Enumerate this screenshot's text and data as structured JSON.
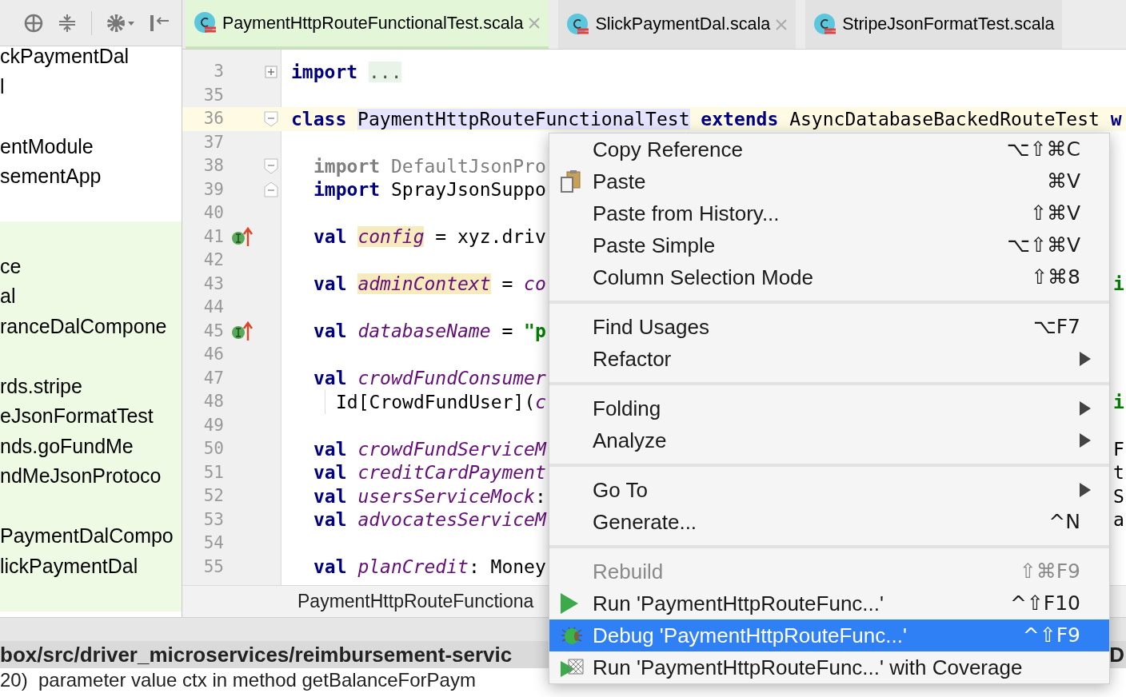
{
  "project_tree": {
    "items": [
      {
        "label": "ckPaymentDal",
        "highlighted": false
      },
      {
        "label": "l",
        "highlighted": false
      },
      {
        "highlighted": false
      },
      {
        "label": "entModule",
        "highlighted": false
      },
      {
        "label": "sementApp",
        "highlighted": false
      },
      {
        "highlighted": false
      },
      {
        "highlighted": true
      },
      {
        "label": "ce",
        "highlighted": true
      },
      {
        "label": "al",
        "highlighted": true
      },
      {
        "label": "ranceDalCompone",
        "highlighted": true
      },
      {
        "highlighted": true
      },
      {
        "label": "rds.stripe",
        "highlighted": true
      },
      {
        "label": "eJsonFormatTest",
        "highlighted": true
      },
      {
        "label": "nds.goFundMe",
        "highlighted": true
      },
      {
        "label": "ndMeJsonProtoco",
        "highlighted": true
      },
      {
        "highlighted": true
      },
      {
        "label": "PaymentDalCompo",
        "highlighted": true
      },
      {
        "label": "lickPaymentDal",
        "highlighted": true
      },
      {
        "highlighted": true
      }
    ]
  },
  "tabs": [
    {
      "label": "PaymentHttpRouteFunctionalTest.scala",
      "selected": true,
      "closable": true
    },
    {
      "label": "SlickPaymentDal.scala",
      "selected": false,
      "closable": true
    },
    {
      "label": "StripeJsonFormatTest.scala",
      "selected": false,
      "closable": false
    }
  ],
  "editor": {
    "lines": [
      {
        "number": "3",
        "fold": {
          "kind": "expand"
        },
        "tokens": [
          {
            "text": "import ",
            "kind": "kw"
          },
          {
            "text": "...",
            "kind": "folded"
          }
        ]
      },
      {
        "number": "35"
      },
      {
        "number": "36",
        "current": true,
        "fold": {
          "kind": "start"
        },
        "tokens": [
          {
            "text": "class ",
            "kind": "kw"
          },
          {
            "text": "PaymentHttpRouteFunctionalTest",
            "kind": "classhl"
          },
          {
            "text": " extends",
            "kind": "kw"
          },
          {
            "text": " AsyncDatabaseBackedRouteTest",
            "kind": "plain"
          },
          {
            "text": " w",
            "kind": "kw"
          }
        ]
      },
      {
        "number": "37"
      },
      {
        "number": "38",
        "fold": {
          "kind": "start"
        },
        "kind": "member",
        "tokens": [
          {
            "text": "import",
            "kind": "unusedkw"
          },
          {
            "text": " DefaultJsonPro",
            "kind": "unused"
          }
        ]
      },
      {
        "number": "39",
        "fold": {
          "kind": "end"
        },
        "kind": "member",
        "tokens": [
          {
            "text": "import",
            "kind": "kw"
          },
          {
            "text": " SprayJsonSuppo",
            "kind": "plain"
          }
        ]
      },
      {
        "number": "40"
      },
      {
        "number": "41",
        "marker": true,
        "kind": "member",
        "tokens": [
          {
            "text": "val ",
            "kind": "kw"
          },
          {
            "text": "config",
            "kind": "fieldhl"
          },
          {
            "text": " = xyz.driv",
            "kind": "plain"
          }
        ]
      },
      {
        "number": "42"
      },
      {
        "number": "43",
        "kind": "member",
        "tokens": [
          {
            "text": "val ",
            "kind": "kw"
          },
          {
            "text": "adminContext",
            "kind": "fieldhl"
          },
          {
            "text": " = ",
            "kind": "plain"
          },
          {
            "text": "co",
            "kind": "field"
          }
        ],
        "right": {
          "text": "i",
          "kind": "str"
        }
      },
      {
        "number": "44"
      },
      {
        "number": "45",
        "marker": true,
        "kind": "member",
        "tokens": [
          {
            "text": "val ",
            "kind": "kw"
          },
          {
            "text": "databaseName",
            "kind": "field"
          },
          {
            "text": " = ",
            "kind": "plain"
          },
          {
            "text": "\"p",
            "kind": "str"
          }
        ]
      },
      {
        "number": "46"
      },
      {
        "number": "47",
        "kind": "member",
        "tokens": [
          {
            "text": "val ",
            "kind": "kw"
          },
          {
            "text": "crowdFundConsumer",
            "kind": "field"
          }
        ]
      },
      {
        "number": "48",
        "kind": "continuation",
        "tokens": [
          {
            "text": "Id[CrowdFundUser](",
            "kind": "plain"
          },
          {
            "text": "c",
            "kind": "field"
          }
        ],
        "right": {
          "text": "i",
          "kind": "str"
        }
      },
      {
        "number": "49"
      },
      {
        "number": "50",
        "kind": "member",
        "tokens": [
          {
            "text": "val ",
            "kind": "kw"
          },
          {
            "text": "crowdFundServiceM",
            "kind": "field"
          }
        ],
        "right": {
          "text": "F",
          "kind": "plain"
        }
      },
      {
        "number": "51",
        "kind": "member",
        "tokens": [
          {
            "text": "val ",
            "kind": "kw"
          },
          {
            "text": "creditCardPayment",
            "kind": "field"
          }
        ],
        "right": {
          "text": "t",
          "kind": "plain"
        }
      },
      {
        "number": "52",
        "kind": "member",
        "tokens": [
          {
            "text": "val ",
            "kind": "kw"
          },
          {
            "text": "usersServiceMock",
            "kind": "field"
          },
          {
            "text": ":",
            "kind": "plain"
          }
        ],
        "right": {
          "text": "S",
          "kind": "plain"
        }
      },
      {
        "number": "53",
        "kind": "member",
        "tokens": [
          {
            "text": "val ",
            "kind": "kw"
          },
          {
            "text": "advocatesServiceM",
            "kind": "field"
          }
        ],
        "right": {
          "text": "a",
          "kind": "plain"
        }
      },
      {
        "number": "54"
      },
      {
        "number": "55",
        "kind": "member",
        "tokens": [
          {
            "text": "val ",
            "kind": "kw"
          },
          {
            "text": "planCredit",
            "kind": "field"
          },
          {
            "text": ": Money",
            "kind": "plain"
          }
        ]
      }
    ],
    "breadcrumb": "PaymentHttpRouteFunctiona"
  },
  "context_menu": {
    "items": [
      {
        "kind": "item",
        "label": "Copy Reference",
        "shortcut": "⌥⇧⌘C",
        "selected": false,
        "disabled": false
      },
      {
        "kind": "item",
        "label": "Paste",
        "shortcut": "⌘V",
        "icon": {
          "kind": "paste"
        },
        "selected": false,
        "disabled": false
      },
      {
        "kind": "item",
        "label": "Paste from History...",
        "shortcut": "⇧⌘V",
        "selected": false,
        "disabled": false
      },
      {
        "kind": "item",
        "label": "Paste Simple",
        "shortcut": "⌥⇧⌘V",
        "selected": false,
        "disabled": false
      },
      {
        "kind": "item",
        "label": "Column Selection Mode",
        "shortcut": "⇧⌘8",
        "selected": false,
        "disabled": false
      },
      {
        "kind": "separator"
      },
      {
        "kind": "item",
        "label": "Find Usages",
        "shortcut": "⌥F7",
        "selected": false,
        "disabled": false
      },
      {
        "kind": "submenu",
        "label": "Refactor",
        "selected": false,
        "disabled": false
      },
      {
        "kind": "separator"
      },
      {
        "kind": "submenu",
        "label": "Folding",
        "selected": false,
        "disabled": false
      },
      {
        "kind": "submenu",
        "label": "Analyze",
        "selected": false,
        "disabled": false
      },
      {
        "kind": "separator"
      },
      {
        "kind": "submenu",
        "label": "Go To",
        "selected": false,
        "disabled": false
      },
      {
        "kind": "item",
        "label": "Generate...",
        "shortcut": "^N",
        "selected": false,
        "disabled": false
      },
      {
        "kind": "separator"
      },
      {
        "kind": "item",
        "label": "Rebuild",
        "shortcut": "⇧⌘F9",
        "selected": false,
        "disabled": true
      },
      {
        "kind": "item",
        "label": "Run 'PaymentHttpRouteFunc...'",
        "shortcut": "^⇧F10",
        "icon": {
          "kind": "run"
        },
        "selected": false,
        "disabled": false
      },
      {
        "kind": "item",
        "label": "Debug 'PaymentHttpRouteFunc...'",
        "shortcut": "^⇧F9",
        "icon": {
          "kind": "debug"
        },
        "selected": true,
        "disabled": false
      },
      {
        "kind": "item",
        "label": "Run 'PaymentHttpRouteFunc...' with Coverage",
        "icon": {
          "kind": "coverage"
        },
        "selected": false,
        "disabled": false
      }
    ]
  },
  "status": {
    "path": "box/src/driver_microservices/reimbursement-servic",
    "path_right": "D",
    "message": "20)  parameter value ctx in method getBalanceForPaym"
  }
}
